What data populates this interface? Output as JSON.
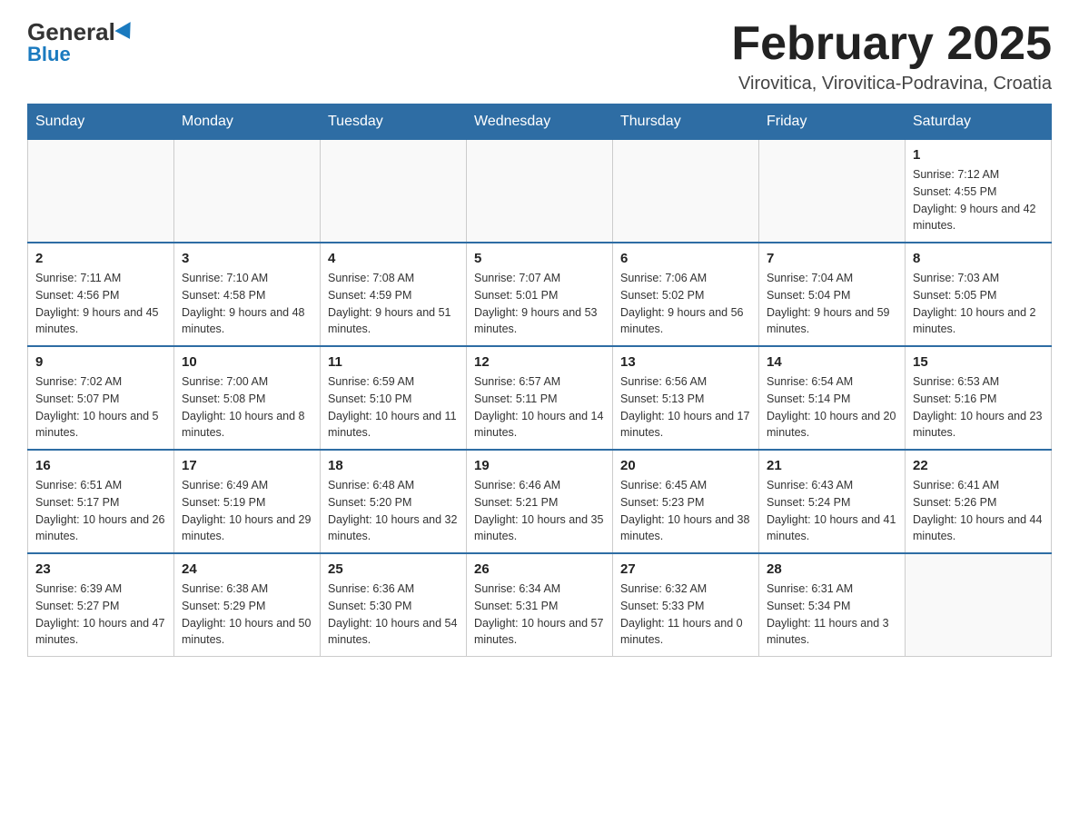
{
  "logo": {
    "general": "General",
    "blue": "Blue"
  },
  "header": {
    "title": "February 2025",
    "location": "Virovitica, Virovitica-Podravina, Croatia"
  },
  "weekdays": [
    "Sunday",
    "Monday",
    "Tuesday",
    "Wednesday",
    "Thursday",
    "Friday",
    "Saturday"
  ],
  "weeks": [
    {
      "days": [
        {
          "number": "",
          "info": ""
        },
        {
          "number": "",
          "info": ""
        },
        {
          "number": "",
          "info": ""
        },
        {
          "number": "",
          "info": ""
        },
        {
          "number": "",
          "info": ""
        },
        {
          "number": "",
          "info": ""
        },
        {
          "number": "1",
          "info": "Sunrise: 7:12 AM\nSunset: 4:55 PM\nDaylight: 9 hours and 42 minutes."
        }
      ]
    },
    {
      "days": [
        {
          "number": "2",
          "info": "Sunrise: 7:11 AM\nSunset: 4:56 PM\nDaylight: 9 hours and 45 minutes."
        },
        {
          "number": "3",
          "info": "Sunrise: 7:10 AM\nSunset: 4:58 PM\nDaylight: 9 hours and 48 minutes."
        },
        {
          "number": "4",
          "info": "Sunrise: 7:08 AM\nSunset: 4:59 PM\nDaylight: 9 hours and 51 minutes."
        },
        {
          "number": "5",
          "info": "Sunrise: 7:07 AM\nSunset: 5:01 PM\nDaylight: 9 hours and 53 minutes."
        },
        {
          "number": "6",
          "info": "Sunrise: 7:06 AM\nSunset: 5:02 PM\nDaylight: 9 hours and 56 minutes."
        },
        {
          "number": "7",
          "info": "Sunrise: 7:04 AM\nSunset: 5:04 PM\nDaylight: 9 hours and 59 minutes."
        },
        {
          "number": "8",
          "info": "Sunrise: 7:03 AM\nSunset: 5:05 PM\nDaylight: 10 hours and 2 minutes."
        }
      ]
    },
    {
      "days": [
        {
          "number": "9",
          "info": "Sunrise: 7:02 AM\nSunset: 5:07 PM\nDaylight: 10 hours and 5 minutes."
        },
        {
          "number": "10",
          "info": "Sunrise: 7:00 AM\nSunset: 5:08 PM\nDaylight: 10 hours and 8 minutes."
        },
        {
          "number": "11",
          "info": "Sunrise: 6:59 AM\nSunset: 5:10 PM\nDaylight: 10 hours and 11 minutes."
        },
        {
          "number": "12",
          "info": "Sunrise: 6:57 AM\nSunset: 5:11 PM\nDaylight: 10 hours and 14 minutes."
        },
        {
          "number": "13",
          "info": "Sunrise: 6:56 AM\nSunset: 5:13 PM\nDaylight: 10 hours and 17 minutes."
        },
        {
          "number": "14",
          "info": "Sunrise: 6:54 AM\nSunset: 5:14 PM\nDaylight: 10 hours and 20 minutes."
        },
        {
          "number": "15",
          "info": "Sunrise: 6:53 AM\nSunset: 5:16 PM\nDaylight: 10 hours and 23 minutes."
        }
      ]
    },
    {
      "days": [
        {
          "number": "16",
          "info": "Sunrise: 6:51 AM\nSunset: 5:17 PM\nDaylight: 10 hours and 26 minutes."
        },
        {
          "number": "17",
          "info": "Sunrise: 6:49 AM\nSunset: 5:19 PM\nDaylight: 10 hours and 29 minutes."
        },
        {
          "number": "18",
          "info": "Sunrise: 6:48 AM\nSunset: 5:20 PM\nDaylight: 10 hours and 32 minutes."
        },
        {
          "number": "19",
          "info": "Sunrise: 6:46 AM\nSunset: 5:21 PM\nDaylight: 10 hours and 35 minutes."
        },
        {
          "number": "20",
          "info": "Sunrise: 6:45 AM\nSunset: 5:23 PM\nDaylight: 10 hours and 38 minutes."
        },
        {
          "number": "21",
          "info": "Sunrise: 6:43 AM\nSunset: 5:24 PM\nDaylight: 10 hours and 41 minutes."
        },
        {
          "number": "22",
          "info": "Sunrise: 6:41 AM\nSunset: 5:26 PM\nDaylight: 10 hours and 44 minutes."
        }
      ]
    },
    {
      "days": [
        {
          "number": "23",
          "info": "Sunrise: 6:39 AM\nSunset: 5:27 PM\nDaylight: 10 hours and 47 minutes."
        },
        {
          "number": "24",
          "info": "Sunrise: 6:38 AM\nSunset: 5:29 PM\nDaylight: 10 hours and 50 minutes."
        },
        {
          "number": "25",
          "info": "Sunrise: 6:36 AM\nSunset: 5:30 PM\nDaylight: 10 hours and 54 minutes."
        },
        {
          "number": "26",
          "info": "Sunrise: 6:34 AM\nSunset: 5:31 PM\nDaylight: 10 hours and 57 minutes."
        },
        {
          "number": "27",
          "info": "Sunrise: 6:32 AM\nSunset: 5:33 PM\nDaylight: 11 hours and 0 minutes."
        },
        {
          "number": "28",
          "info": "Sunrise: 6:31 AM\nSunset: 5:34 PM\nDaylight: 11 hours and 3 minutes."
        },
        {
          "number": "",
          "info": ""
        }
      ]
    }
  ]
}
